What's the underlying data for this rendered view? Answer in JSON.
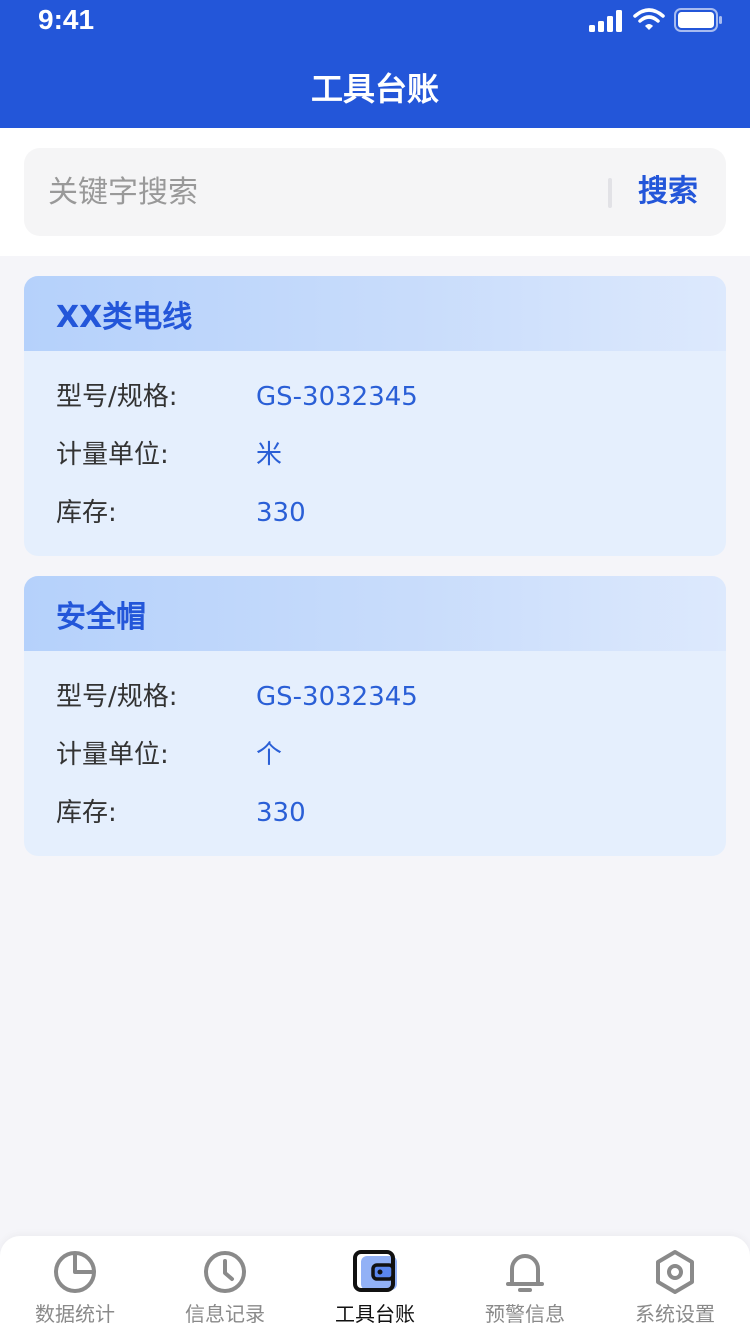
{
  "status_bar": {
    "time": "9:41"
  },
  "header": {
    "title": "工具台账"
  },
  "search": {
    "placeholder": "关键字搜索",
    "button_label": "搜索"
  },
  "cards": [
    {
      "title": "XX类电线",
      "rows": [
        {
          "label": "型号/规格:",
          "value": "GS-3032345"
        },
        {
          "label": "计量单位:",
          "value": "米"
        },
        {
          "label": "库存:",
          "value": "330"
        }
      ]
    },
    {
      "title": "安全帽",
      "rows": [
        {
          "label": "型号/规格:",
          "value": "GS-3032345"
        },
        {
          "label": "计量单位:",
          "value": "个"
        },
        {
          "label": "库存:",
          "value": "330"
        }
      ]
    }
  ],
  "tabs": [
    {
      "label": "数据统计",
      "icon": "pie-chart-icon",
      "active": false
    },
    {
      "label": "信息记录",
      "icon": "clock-icon",
      "active": false
    },
    {
      "label": "工具台账",
      "icon": "wallet-icon",
      "active": true
    },
    {
      "label": "预警信息",
      "icon": "bell-icon",
      "active": false
    },
    {
      "label": "系统设置",
      "icon": "settings-hexagon-icon",
      "active": false
    }
  ],
  "colors": {
    "primary": "#2356d9",
    "card_background": "#e5effd",
    "tab_inactive": "#8a8a8a",
    "tab_active": "#111111"
  }
}
